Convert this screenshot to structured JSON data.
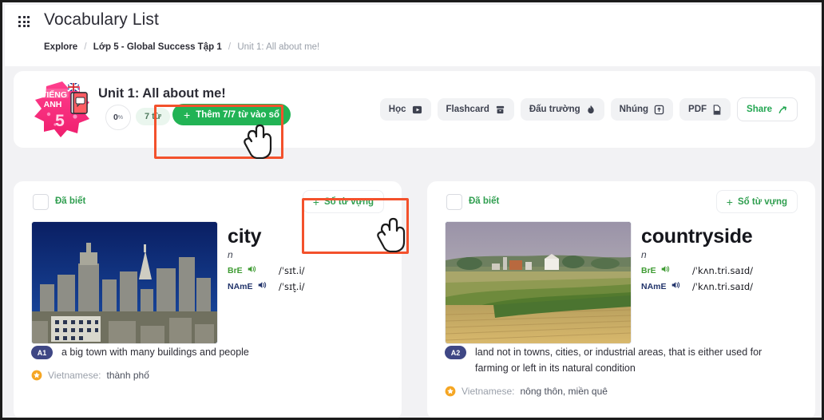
{
  "header": {
    "apps_icon": "grid-apps-icon",
    "title": "Vocabulary List",
    "breadcrumb": {
      "item1": "Explore",
      "sep": "/",
      "item2": "Lớp 5 - Global Success Tập 1",
      "item3": "Unit 1: All about me!"
    }
  },
  "unit": {
    "logo_line1": "TIẾNG",
    "logo_line2": "ANH",
    "logo_number": "5",
    "name": "Unit 1: All about me!",
    "progress_value": "0",
    "progress_unit": "%",
    "word_count_label": "7 từ",
    "add_button_label": "Thêm 7/7 từ vào sổ",
    "add_button_plus": "+",
    "actions": [
      {
        "label": "Học",
        "icon": "video-lesson-icon"
      },
      {
        "label": "Flashcard",
        "icon": "flashcard-box-icon"
      },
      {
        "label": "Đấu trường",
        "icon": "flame-icon"
      },
      {
        "label": "Nhúng",
        "icon": "embed-icon"
      },
      {
        "label": "PDF",
        "icon": "pdf-file-icon"
      },
      {
        "label": "Share",
        "icon": "share-arrow-icon"
      }
    ]
  },
  "colors": {
    "accent_green": "#22b355",
    "highlight_red": "#f3512c",
    "level_badge": "#3f4785",
    "star_orange": "#f5a623"
  },
  "cards": [
    {
      "known_label": "Đã biết",
      "notebook_button_label": "Sổ từ vựng",
      "notebook_button_plus": "+",
      "image_alt": "city-skyline-photo",
      "word": "city",
      "pos": "n",
      "bre_label": "BrE",
      "bre_ipa": "/ˈsɪt.i/",
      "name_label": "NAmE",
      "name_ipa": "/ˈsɪt̬.i/",
      "level": "A1",
      "definition": "a big town with many buildings and people",
      "vietnamese_label": "Vietnamese:",
      "vietnamese_text": "thành phố"
    },
    {
      "known_label": "Đã biết",
      "notebook_button_label": "Sổ từ vựng",
      "notebook_button_plus": "+",
      "image_alt": "countryside-farm-field-photo",
      "word": "countryside",
      "pos": "n",
      "bre_label": "BrE",
      "bre_ipa": "/ˈkʌn.tri.saɪd/",
      "name_label": "NAmE",
      "name_ipa": "/ˈkʌn.tri.saɪd/",
      "level": "A2",
      "definition": "land not in towns, cities, or industrial areas, that is either used for farming or left in its natural condition",
      "vietnamese_label": "Vietnamese:",
      "vietnamese_text": "nông thôn, miền quê"
    }
  ]
}
